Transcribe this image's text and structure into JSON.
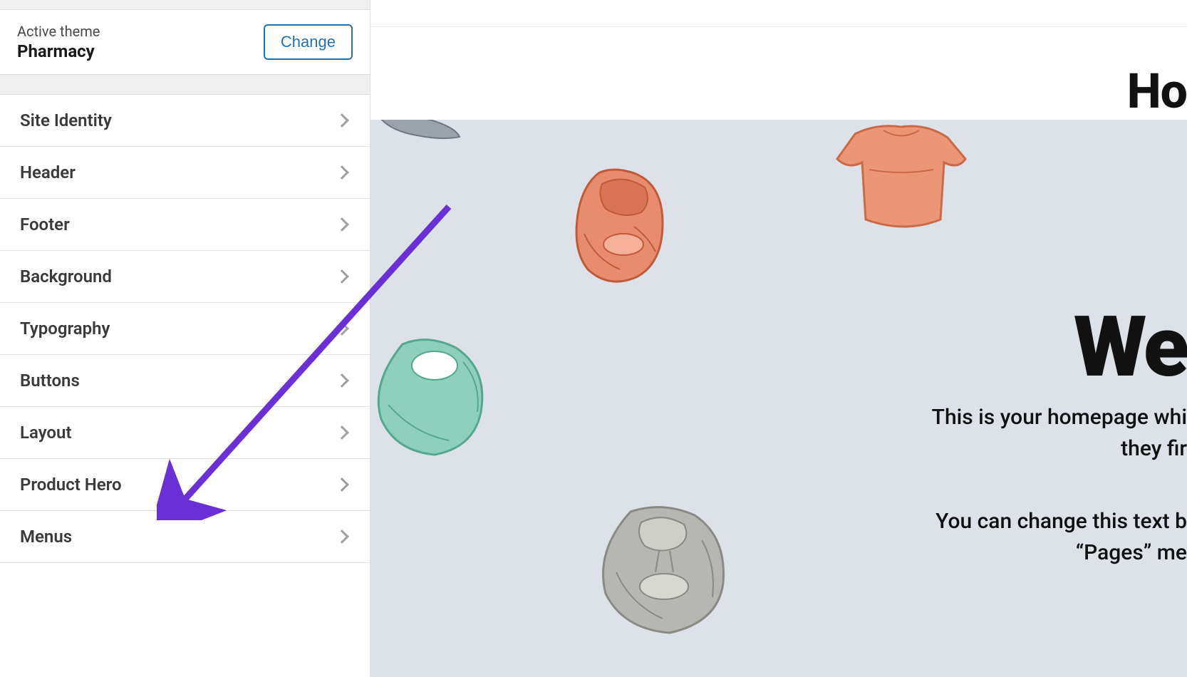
{
  "sidebar": {
    "active_theme_label": "Active theme",
    "theme_name": "Pharmacy",
    "change_btn": "Change",
    "items": [
      {
        "label": "Site Identity"
      },
      {
        "label": "Header"
      },
      {
        "label": "Footer"
      },
      {
        "label": "Background"
      },
      {
        "label": "Typography"
      },
      {
        "label": "Buttons"
      },
      {
        "label": "Layout"
      },
      {
        "label": "Product Hero"
      },
      {
        "label": "Menus"
      }
    ]
  },
  "preview": {
    "page_title_partial": "Ho",
    "welcome_heading_partial": "We",
    "line1": "This is your homepage whi",
    "line2": "they fir",
    "line3": "You can change this text b",
    "line4": "“Pages” me"
  }
}
